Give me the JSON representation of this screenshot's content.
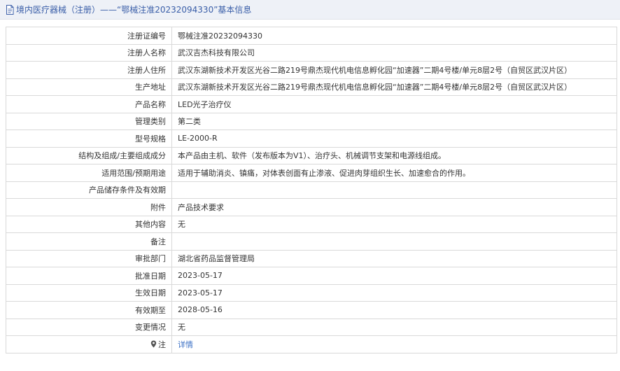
{
  "header": {
    "title": "境内医疗器械（注册）——“鄂械注准20232094330”基本信息",
    "icon": "document-icon"
  },
  "rows": [
    {
      "key": "reg-no",
      "label": "注册证编号",
      "value": "鄂械注准20232094330"
    },
    {
      "key": "registrant-name",
      "label": "注册人名称",
      "value": "武汉吉杰科技有限公司"
    },
    {
      "key": "registrant-address",
      "label": "注册人住所",
      "value": "武汉东湖新技术开发区光谷二路219号鼎杰现代机电信息孵化园“加速器”二期4号楼/单元8层2号（自贸区武汉片区）"
    },
    {
      "key": "production-address",
      "label": "生产地址",
      "value": "武汉东湖新技术开发区光谷二路219号鼎杰现代机电信息孵化园“加速器”二期4号楼/单元8层2号（自贸区武汉片区）"
    },
    {
      "key": "product-name",
      "label": "产品名称",
      "value": "LED光子治疗仪"
    },
    {
      "key": "management-class",
      "label": "管理类别",
      "value": "第二类"
    },
    {
      "key": "model-spec",
      "label": "型号规格",
      "value": "LE-2000-R"
    },
    {
      "key": "structure",
      "label": "结构及组成/主要组成成分",
      "value": "本产品由主机、软件（发布版本为V1）、治疗头、机械调节支架和电源线组成。"
    },
    {
      "key": "scope",
      "label": "适用范围/预期用途",
      "value": "适用于辅助消炎、镇痛，对体表创面有止渗液、促进肉芽组织生长、加速愈合的作用。"
    },
    {
      "key": "storage",
      "label": "产品储存条件及有效期",
      "value": ""
    },
    {
      "key": "attachment",
      "label": "附件",
      "value": "产品技术要求"
    },
    {
      "key": "other",
      "label": "其他内容",
      "value": "无"
    },
    {
      "key": "remarks",
      "label": "备注",
      "value": ""
    },
    {
      "key": "approval-dept",
      "label": "审批部门",
      "value": "湖北省药品监督管理局"
    },
    {
      "key": "approval-date",
      "label": "批准日期",
      "value": "2023-05-17"
    },
    {
      "key": "effective-date",
      "label": "生效日期",
      "value": "2023-05-17"
    },
    {
      "key": "expiry-date",
      "label": "有效期至",
      "value": "2028-05-16"
    },
    {
      "key": "change-status",
      "label": "变更情况",
      "value": "无"
    }
  ],
  "note": {
    "label": "注",
    "icon": "pin-icon",
    "link_text": "详情",
    "link_color": "#3a6fc4"
  },
  "colors": {
    "title_text": "#3a5ea8",
    "title_bg": "#eef1f7",
    "border": "#d9d9d9"
  }
}
